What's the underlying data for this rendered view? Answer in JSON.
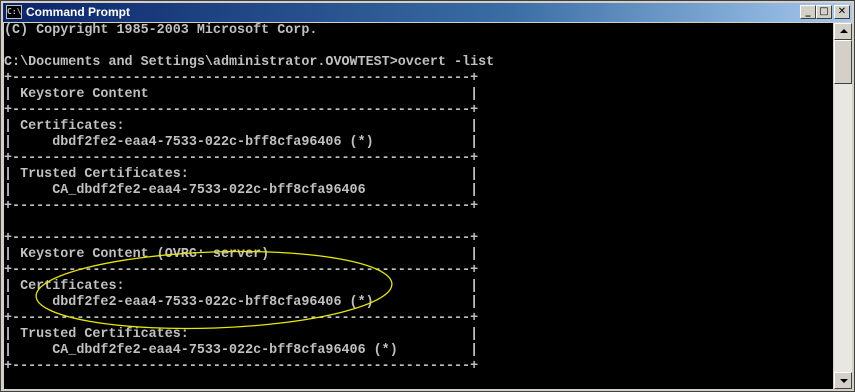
{
  "window": {
    "title": "Command Prompt",
    "icon_text": "C:\\",
    "icon_name": "console-icon",
    "buttons": {
      "minimize": "_",
      "maximize": "□",
      "close": "✕"
    }
  },
  "console": {
    "lines": [
      "(C) Copyright 1985-2003 Microsoft Corp.",
      "",
      "C:\\Documents and Settings\\administrator.OVOWTEST>ovcert -list",
      "+---------------------------------------------------------+",
      "| Keystore Content                                        |",
      "+---------------------------------------------------------+",
      "| Certificates:                                           |",
      "|     dbdf2fe2-eaa4-7533-022c-bff8cfa96406 (*)            |",
      "+---------------------------------------------------------+",
      "| Trusted Certificates:                                   |",
      "|     CA_dbdf2fe2-eaa4-7533-022c-bff8cfa96406             |",
      "+---------------------------------------------------------+",
      "",
      "+---------------------------------------------------------+",
      "| Keystore Content (OVRG: server)                         |",
      "+---------------------------------------------------------+",
      "| Certificates:                                           |",
      "|     dbdf2fe2-eaa4-7533-022c-bff8cfa96406 (*)            |",
      "+---------------------------------------------------------+",
      "| Trusted Certificates:                                   |",
      "|     CA_dbdf2fe2-eaa4-7533-022c-bff8cfa96406 (*)         |",
      "+---------------------------------------------------------+"
    ],
    "text_color": "#c0c0c0",
    "background_color": "#000000",
    "annotation_color": "#e8e800"
  }
}
